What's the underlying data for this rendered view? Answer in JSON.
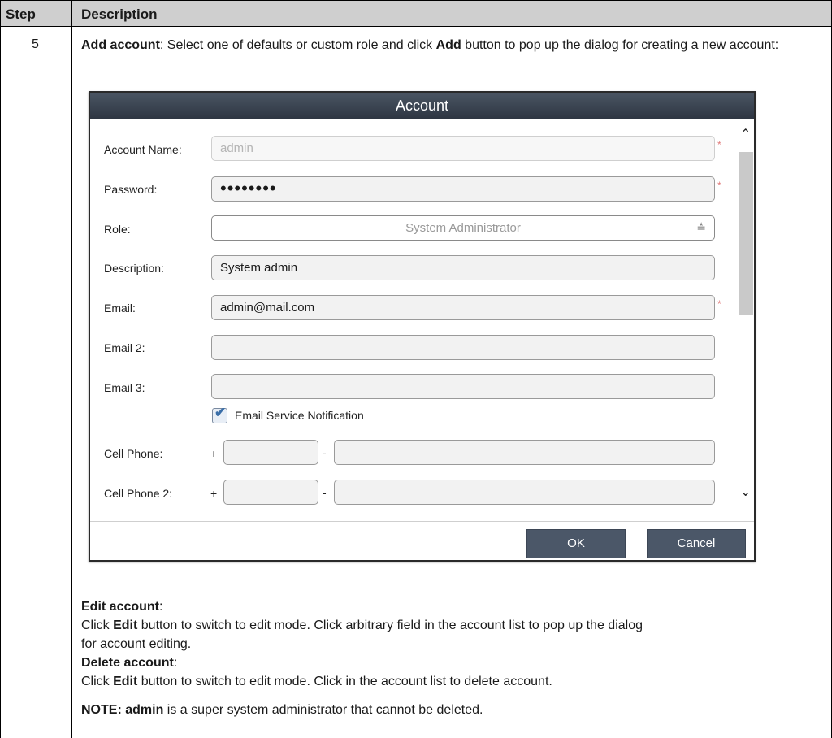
{
  "table": {
    "header_step": "Step",
    "header_description": "Description",
    "step_number": "5"
  },
  "add_account": {
    "title": "Add account",
    "text_1": ": Select one of defaults or custom role and click ",
    "bold_add": "Add",
    "text_2": " button to pop up the dialog for creating a new account:"
  },
  "dialog": {
    "title": "Account",
    "fields": {
      "account_name": {
        "label": "Account Name:",
        "value": "admin"
      },
      "password": {
        "label": "Password:",
        "value": "••••••••"
      },
      "role": {
        "label": "Role:",
        "value": "System Administrator"
      },
      "description": {
        "label": "Description:",
        "value": "System admin"
      },
      "email": {
        "label": "Email:",
        "value": "admin@mail.com"
      },
      "email2": {
        "label": "Email 2:",
        "value": ""
      },
      "email3": {
        "label": "Email 3:",
        "value": ""
      }
    },
    "email_notification": {
      "label": "Email Service Notification",
      "checked": true
    },
    "cell_phone": {
      "label": "Cell Phone:",
      "plus": "+",
      "dash": "-"
    },
    "cell_phone2": {
      "label": "Cell Phone 2:",
      "plus": "+",
      "dash": "-"
    },
    "required_mark": "*",
    "ok_label": "OK",
    "cancel_label": "Cancel"
  },
  "edit_account": {
    "title": "Edit account",
    "colon": ":",
    "line1_a": "Click ",
    "line1_bold": "Edit",
    "line1_b": " button to switch to edit mode. Click arbitrary field in the account list to pop up the dialog",
    "line2": "for account editing."
  },
  "delete_account": {
    "title": "Delete account",
    "colon": ":",
    "line1_a": "Click ",
    "line1_bold": "Edit",
    "line1_b": " button to switch to edit mode. Click in the account list to delete account."
  },
  "note": {
    "label": "NOTE:",
    "bold_admin": "admin",
    "text": " is a super system administrator that cannot be deleted."
  },
  "icons": {
    "role_dropdown": "chevron-double-down-icon",
    "scroll_up": "chevron-up-icon",
    "scroll_down": "chevron-down-icon",
    "checkbox": "checkmark-icon"
  },
  "colors": {
    "title_bar": "#2d3541",
    "button": "#4b5768",
    "required": "#e07a7a",
    "table_header": "#cfcfcf"
  }
}
